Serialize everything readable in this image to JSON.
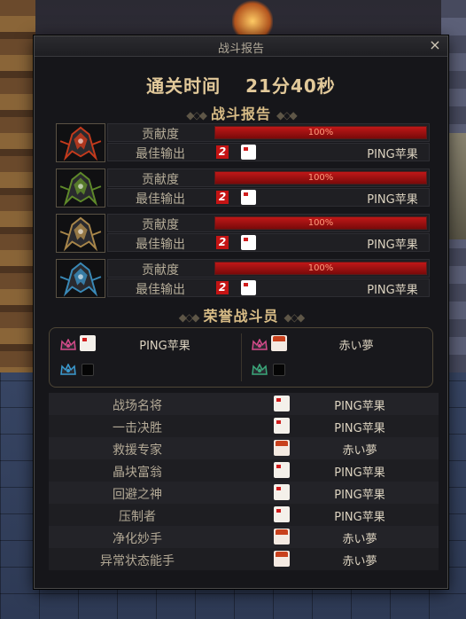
{
  "window": {
    "title": "战斗报告",
    "close": "×"
  },
  "clear_time": {
    "label": "通关时间",
    "value": "21分40秒"
  },
  "report_heading": "战斗报告",
  "party": [
    {
      "contribution_label": "贡献度",
      "contribution_pct": "100%",
      "contribution_value": 100,
      "best_output_label": "最佳输出",
      "rank_badge": "2",
      "player": "PING苹果",
      "theme": "#c43a1c"
    },
    {
      "contribution_label": "贡献度",
      "contribution_pct": "100%",
      "contribution_value": 100,
      "best_output_label": "最佳输出",
      "rank_badge": "2",
      "player": "PING苹果",
      "theme": "#5f8a2a"
    },
    {
      "contribution_label": "贡献度",
      "contribution_pct": "100%",
      "contribution_value": 100,
      "best_output_label": "最佳输出",
      "rank_badge": "2",
      "player": "PING苹果",
      "theme": "#a8864a"
    },
    {
      "contribution_label": "贡献度",
      "contribution_pct": "100%",
      "contribution_value": 100,
      "best_output_label": "最佳输出",
      "rank_badge": "2",
      "player": "PING苹果",
      "theme": "#3a8ab8"
    }
  ],
  "honor_heading": "荣誉战斗员",
  "honor": [
    {
      "player": "PING苹果",
      "face": "white",
      "crown": "#d44a8a"
    },
    {
      "player": "赤い夢",
      "face": "red",
      "crown": "#d44a8a"
    },
    {
      "player": "",
      "face": "empty",
      "crown": "#3a9ad0"
    },
    {
      "player": "",
      "face": "empty",
      "crown": "#3aa87a"
    }
  ],
  "awards": [
    {
      "name": "战场名将",
      "player": "PING苹果",
      "face": "white"
    },
    {
      "name": "一击决胜",
      "player": "PING苹果",
      "face": "white"
    },
    {
      "name": "救援专家",
      "player": "赤い夢",
      "face": "red"
    },
    {
      "name": "晶块富翁",
      "player": "PING苹果",
      "face": "white"
    },
    {
      "name": "回避之神",
      "player": "PING苹果",
      "face": "white"
    },
    {
      "name": "压制者",
      "player": "PING苹果",
      "face": "white"
    },
    {
      "name": "净化妙手",
      "player": "赤い夢",
      "face": "red"
    },
    {
      "name": "异常状态能手",
      "player": "赤い夢",
      "face": "red"
    }
  ]
}
